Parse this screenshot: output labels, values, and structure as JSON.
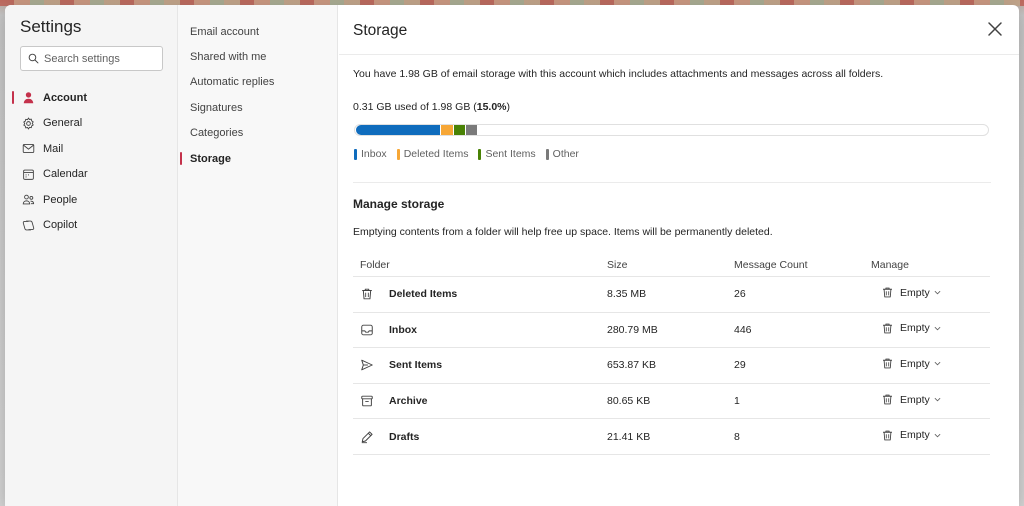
{
  "nav": {
    "title": "Settings",
    "search_placeholder": "Search settings",
    "items": [
      {
        "label": "Account",
        "icon": "person-icon",
        "active": true
      },
      {
        "label": "General",
        "icon": "gear-icon"
      },
      {
        "label": "Mail",
        "icon": "mail-icon"
      },
      {
        "label": "Calendar",
        "icon": "calendar-icon"
      },
      {
        "label": "People",
        "icon": "people-icon"
      },
      {
        "label": "Copilot",
        "icon": "copilot-icon"
      }
    ]
  },
  "subnav": {
    "items": [
      {
        "label": "Email account"
      },
      {
        "label": "Shared with me"
      },
      {
        "label": "Automatic replies"
      },
      {
        "label": "Signatures"
      },
      {
        "label": "Categories"
      },
      {
        "label": "Storage",
        "active": true
      }
    ]
  },
  "main": {
    "title": "Storage",
    "description": "You have 1.98 GB of email storage with this account which includes attachments and messages across all folders.",
    "usage_prefix": "0.31 GB used of 1.98 GB (",
    "usage_percent": "15.0%",
    "usage_suffix": ")",
    "bar": {
      "total_gb": 1.98,
      "segments": [
        {
          "name": "Inbox",
          "fraction_of_track": 0.133,
          "color": "#0f6cbd"
        },
        {
          "name": "Deleted Items",
          "fraction_of_track": 0.019,
          "color": "#f7a736"
        },
        {
          "name": "Sent Items",
          "fraction_of_track": 0.018,
          "color": "#498205"
        },
        {
          "name": "Other",
          "fraction_of_track": 0.018,
          "color": "#7a7a7a"
        }
      ]
    },
    "legend": [
      {
        "label": "Inbox",
        "color": "#0f6cbd"
      },
      {
        "label": "Deleted Items",
        "color": "#f7a736"
      },
      {
        "label": "Sent Items",
        "color": "#498205"
      },
      {
        "label": "Other",
        "color": "#7a7a7a"
      }
    ],
    "manage": {
      "title": "Manage storage",
      "description": "Emptying contents from a folder will help free up space. Items will be permanently deleted.",
      "columns": {
        "folder": "Folder",
        "size": "Size",
        "count": "Message Count",
        "manage": "Manage"
      },
      "rows": [
        {
          "folder": "Deleted Items",
          "icon": "trash-icon",
          "size": "8.35 MB",
          "count": "26",
          "action": "Empty"
        },
        {
          "folder": "Inbox",
          "icon": "inbox-icon",
          "size": "280.79 MB",
          "count": "446",
          "action": "Empty"
        },
        {
          "folder": "Sent Items",
          "icon": "send-icon",
          "size": "653.87 KB",
          "count": "29",
          "action": "Empty"
        },
        {
          "folder": "Archive",
          "icon": "archive-icon",
          "size": "80.65 KB",
          "count": "1",
          "action": "Empty"
        },
        {
          "folder": "Drafts",
          "icon": "pencil-icon",
          "size": "21.41 KB",
          "count": "8",
          "action": "Empty"
        }
      ]
    }
  },
  "colors": {
    "accent": "#c4314b",
    "inbox": "#0f6cbd",
    "deleted": "#f7a736",
    "sent": "#498205",
    "other": "#7a7a7a"
  }
}
